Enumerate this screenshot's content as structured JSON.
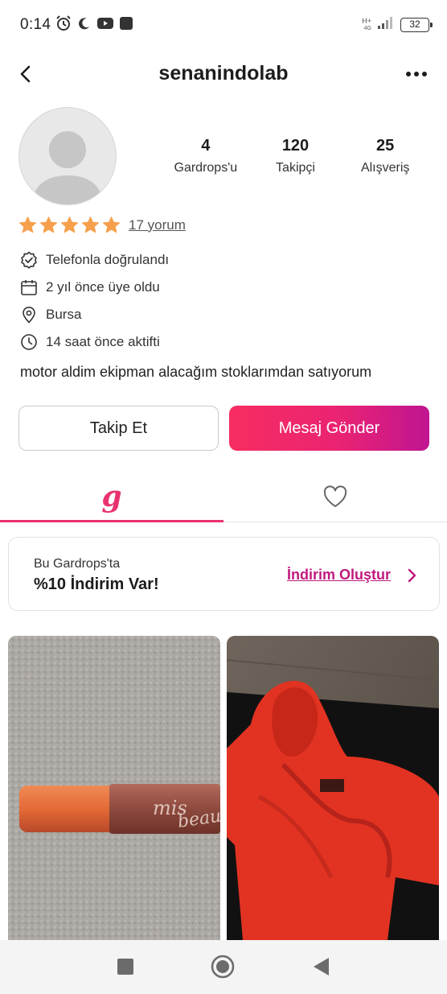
{
  "status_bar": {
    "time": "0:14",
    "network_type": "H+",
    "network_sub": "4G",
    "battery": "32",
    "icons": [
      "alarm-icon",
      "moon-icon",
      "youtube-icon",
      "app-icon",
      "signal-icon",
      "battery-icon"
    ]
  },
  "header": {
    "title": "senanindolab",
    "back_icon": "chevron-left-icon",
    "more_icon": "more-horizontal-icon"
  },
  "profile": {
    "avatar_icon": "default-avatar-icon",
    "stats": [
      {
        "value": "4",
        "label": "Gardrops'u"
      },
      {
        "value": "120",
        "label": "Takipçi"
      },
      {
        "value": "25",
        "label": "Alışveriş"
      }
    ],
    "rating": {
      "stars": 5,
      "star_color": "#f6a04d",
      "reviews_label": "17 yorum"
    },
    "info": [
      {
        "icon": "verified-badge-icon",
        "text": "Telefonla doğrulandı"
      },
      {
        "icon": "calendar-icon",
        "text": "2 yıl önce üye oldu"
      },
      {
        "icon": "location-pin-icon",
        "text": "Bursa"
      },
      {
        "icon": "clock-icon",
        "text": "14 saat önce aktifti"
      }
    ],
    "bio": "motor aldim ekipman alacağım stoklarımdan satıyorum"
  },
  "actions": {
    "follow_label": "Takip Et",
    "message_label": "Mesaj Gönder"
  },
  "tabs": [
    {
      "name": "closet",
      "icon": "g-logo-icon",
      "glyph": "g",
      "active": true
    },
    {
      "name": "likes",
      "icon": "heart-icon",
      "active": false
    }
  ],
  "discount": {
    "subtitle": "Bu Gardrops'ta",
    "title": "%10 İndirim Var!",
    "link_label": "İndirim Oluştur",
    "chevron_icon": "chevron-right-icon"
  },
  "products": [
    {
      "image": "product-photo-lip-gloss"
    },
    {
      "image": "product-photo-red-hoodie"
    }
  ],
  "navbar": {
    "icons": [
      "recents-square-icon",
      "home-circle-icon",
      "back-triangle-icon"
    ]
  },
  "colors": {
    "accent": "#e8336e",
    "gradient_start": "#f72d61",
    "gradient_end": "#bf1592",
    "link": "#c0197e",
    "star": "#f6a04d"
  }
}
